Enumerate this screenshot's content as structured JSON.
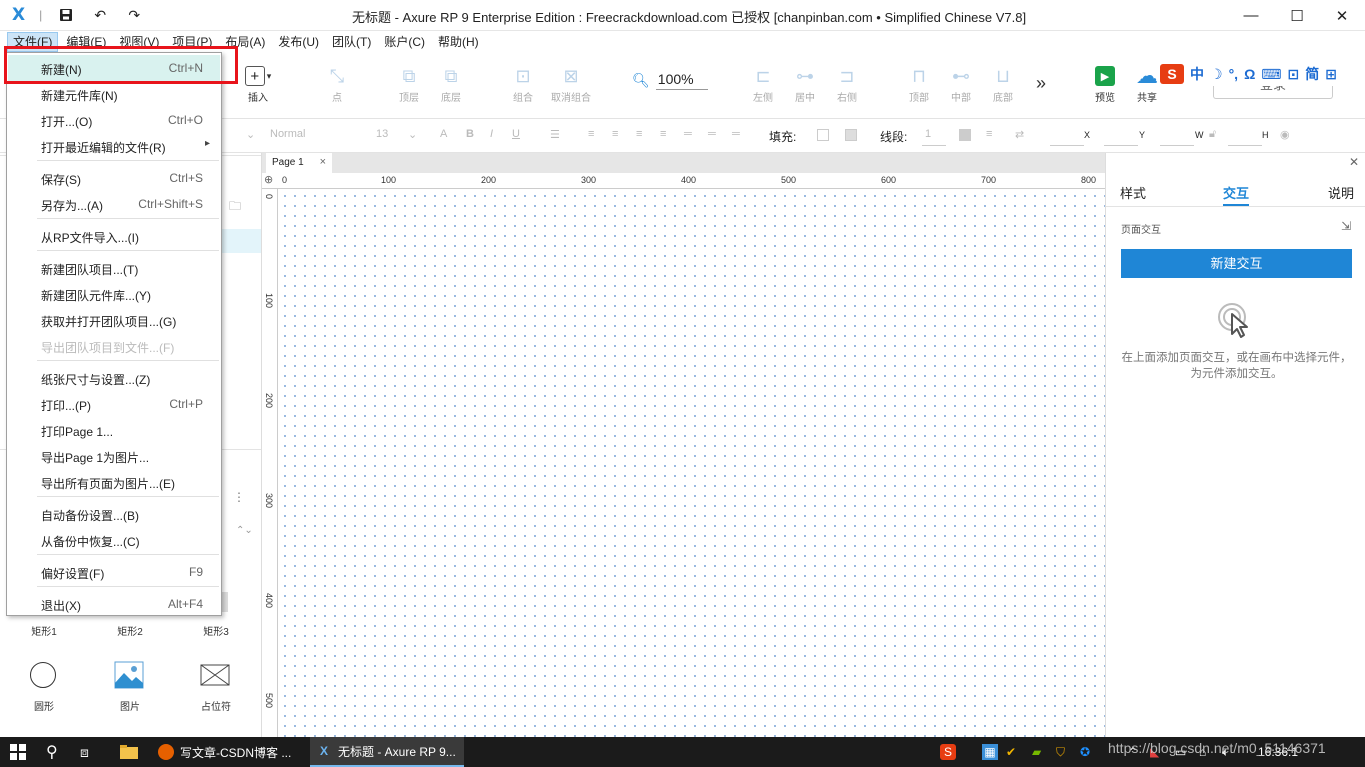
{
  "window": {
    "title": "无标题 - Axure RP 9 Enterprise Edition : Freecrackdownload.com 已授权     [chanpinban.com • Simplified Chinese V7.8]",
    "minimize": "—",
    "maximize": "☐",
    "close": "✕"
  },
  "menubar": [
    "文件(F)",
    "编辑(E)",
    "视图(V)",
    "项目(P)",
    "布局(A)",
    "发布(U)",
    "团队(T)",
    "账户(C)",
    "帮助(H)"
  ],
  "toolbar": {
    "insert": "插入",
    "point": "点",
    "top_layer": "顶层",
    "bottom_layer": "底层",
    "group": "组合",
    "ungroup": "取消组合",
    "zoom": "100%",
    "left": "左侧",
    "center": "居中",
    "right": "右侧",
    "top": "顶部",
    "middle": "中部",
    "bottom": "底部",
    "more": "»",
    "preview": "预览",
    "share": "共享",
    "login": "登录"
  },
  "ime": [
    "S",
    "中",
    "☽",
    "°,",
    "Ω",
    "⌨",
    "⊡",
    "简",
    "⊞"
  ],
  "formatbar": {
    "font": "Normal",
    "size": "13",
    "fill_label": "填充:",
    "line_label": "线段:",
    "line_value": "1",
    "x": "X",
    "y": "Y",
    "w": "W",
    "h": "H"
  },
  "file_menu": [
    {
      "label": "新建(N)",
      "shortcut": "Ctrl+N",
      "highlight": true
    },
    {
      "label": "新建元件库(N)",
      "shortcut": ""
    },
    {
      "label": "打开...(O)",
      "shortcut": "Ctrl+O"
    },
    {
      "label": "打开最近编辑的文件(R)",
      "shortcut": "",
      "submenu": "▸"
    },
    {
      "label": "保存(S)",
      "shortcut": "Ctrl+S"
    },
    {
      "label": "另存为...(A)",
      "shortcut": "Ctrl+Shift+S"
    },
    {
      "label": "从RP文件导入...(I)",
      "shortcut": ""
    },
    {
      "label": "新建团队项目...(T)",
      "shortcut": ""
    },
    {
      "label": "新建团队元件库...(Y)",
      "shortcut": ""
    },
    {
      "label": "获取并打开团队项目...(G)",
      "shortcut": ""
    },
    {
      "label": "导出团队项目到文件...(F)",
      "shortcut": "",
      "disabled": true
    },
    {
      "label": "纸张尺寸与设置...(Z)",
      "shortcut": ""
    },
    {
      "label": "打印...(P)",
      "shortcut": "Ctrl+P"
    },
    {
      "label": "打印Page 1...",
      "shortcut": ""
    },
    {
      "label": "导出Page 1为图片...",
      "shortcut": ""
    },
    {
      "label": "导出所有页面为图片...(E)",
      "shortcut": ""
    },
    {
      "label": "自动备份设置...(B)",
      "shortcut": ""
    },
    {
      "label": "从备份中恢复...(C)",
      "shortcut": ""
    },
    {
      "label": "偏好设置(F)",
      "shortcut": "F9"
    },
    {
      "label": "退出(X)",
      "shortcut": "Alt+F4"
    }
  ],
  "library": {
    "rect1": "矩形1",
    "rect2": "矩形2",
    "rect3": "矩形3",
    "circle": "圆形",
    "image": "图片",
    "placeholder": "占位符"
  },
  "canvas": {
    "tab": "Page 1",
    "ruler_x": [
      "0",
      "100",
      "200",
      "300",
      "400",
      "500",
      "600",
      "700",
      "800"
    ],
    "ruler_y": [
      "0",
      "100",
      "200",
      "300",
      "400",
      "500"
    ]
  },
  "right_panel": {
    "tabs": [
      "样式",
      "交互",
      "说明"
    ],
    "active_tab": "交互",
    "section": "页面交互",
    "button": "新建交互",
    "hint": "在上面添加页面交互，或在画布中选择元件，为元件添加交互。"
  },
  "taskbar": {
    "firefox": "写文章-CSDN博客 ...",
    "axure": "无标题 - Axure RP 9...",
    "clock": "16:36:1",
    "watermark": "https://blog.csdn.net/m0_51146371"
  },
  "colors": {
    "accent": "#1f86d6",
    "highlight": "#d9f2ef",
    "red_box": "#e8141b"
  }
}
